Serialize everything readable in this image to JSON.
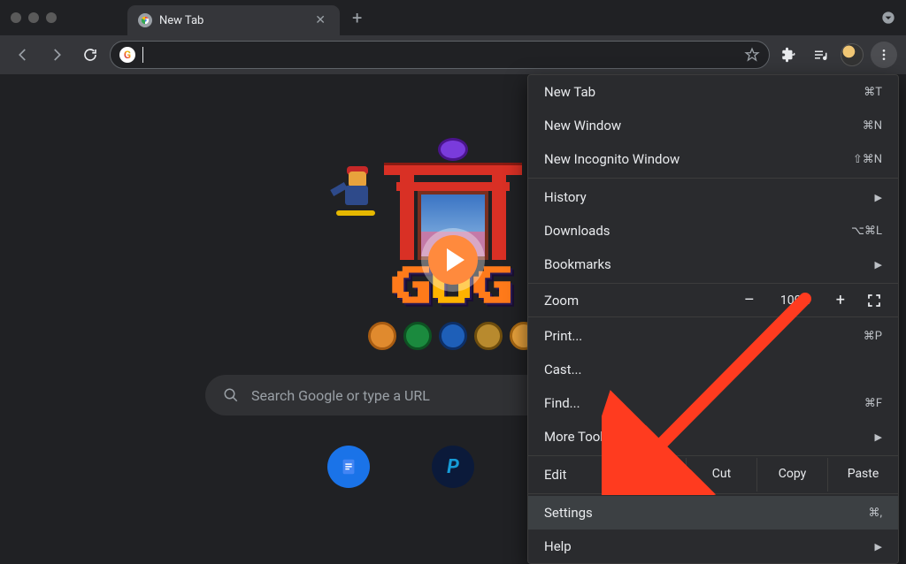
{
  "window": {
    "tab_title": "New Tab",
    "new_tab_plus": "+"
  },
  "toolbar": {
    "omnibox_value": "",
    "g_letter": "G"
  },
  "content": {
    "search_placeholder": "Search Google or type a URL",
    "doodle_letters": {
      "g1": "G",
      "o1": "O",
      "g2": "G"
    },
    "shortcut_paypal": "P"
  },
  "menu": {
    "items": {
      "new_tab": {
        "label": "New Tab",
        "shortcut": "⌘T"
      },
      "new_window": {
        "label": "New Window",
        "shortcut": "⌘N"
      },
      "incognito": {
        "label": "New Incognito Window",
        "shortcut": "⇧⌘N"
      },
      "history": {
        "label": "History"
      },
      "downloads": {
        "label": "Downloads",
        "shortcut": "⌥⌘L"
      },
      "bookmarks": {
        "label": "Bookmarks"
      },
      "zoom": {
        "label": "Zoom",
        "value": "100%",
        "minus": "–",
        "plus": "+"
      },
      "print_": {
        "label": "Print...",
        "shortcut": "⌘P"
      },
      "cast": {
        "label": "Cast..."
      },
      "find": {
        "label": "Find...",
        "shortcut": "⌘F"
      },
      "more_tools": {
        "label": "More Tools"
      },
      "edit": {
        "label": "Edit",
        "cut": "Cut",
        "copy": "Copy",
        "paste": "Paste"
      },
      "settings": {
        "label": "Settings",
        "shortcut": "⌘,"
      },
      "help": {
        "label": "Help"
      }
    }
  }
}
